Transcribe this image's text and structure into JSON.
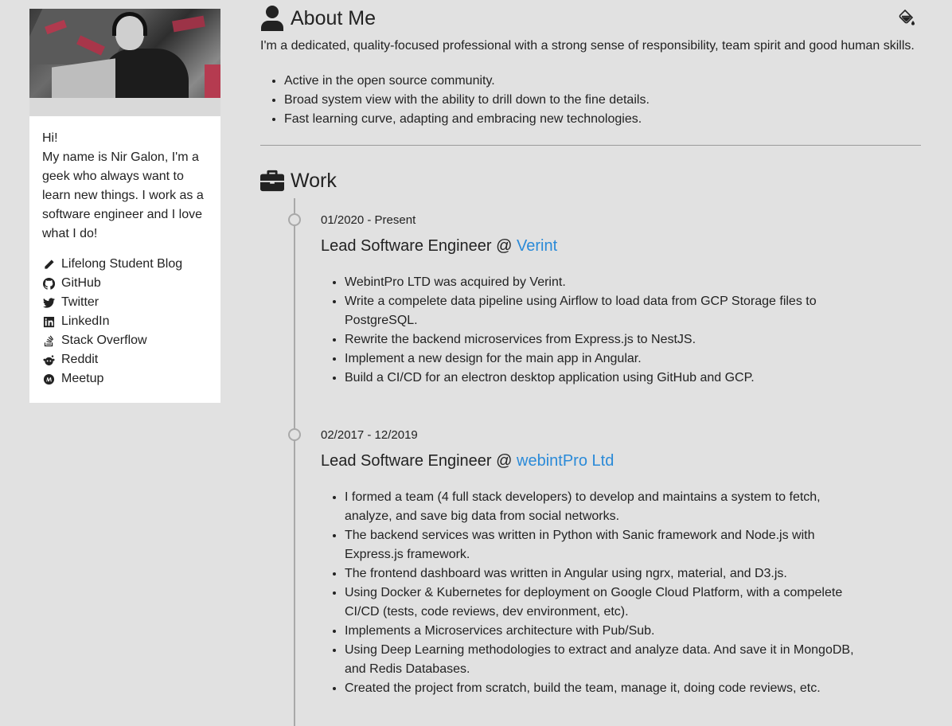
{
  "sidebar": {
    "photo_alt": "",
    "greeting": "Hi!",
    "bio": "My name is Nir Galon, I'm a geek who always want to learn new things. I work as a software engineer and I love what I do!",
    "links": [
      {
        "label": "Lifelong Student Blog",
        "icon": "pencil-icon"
      },
      {
        "label": "GitHub",
        "icon": "github-icon"
      },
      {
        "label": "Twitter",
        "icon": "twitter-icon"
      },
      {
        "label": "LinkedIn",
        "icon": "linkedin-icon"
      },
      {
        "label": "Stack Overflow",
        "icon": "stackoverflow-icon"
      },
      {
        "label": "Reddit",
        "icon": "reddit-icon"
      },
      {
        "label": "Meetup",
        "icon": "meetup-icon"
      }
    ]
  },
  "about": {
    "heading": "About Me",
    "intro": "I'm a dedicated, quality-focused professional with a strong sense of responsibility, team spirit and good human skills.",
    "points": [
      "Active in the open source community.",
      "Broad system view with the ability to drill down to the fine details.",
      "Fast learning curve, adapting and embracing new technologies."
    ]
  },
  "work": {
    "heading": "Work",
    "jobs": [
      {
        "date": "01/2020 - Present",
        "role": "Lead Software Engineer @ ",
        "company": "Verint",
        "points": [
          "WebintPro LTD was acquired by Verint.",
          "Write a compelete data pipeline using Airflow to load data from GCP Storage files to PostgreSQL.",
          "Rewrite the backend microservices from Express.js to NestJS.",
          "Implement a new design for the main app in Angular.",
          "Build a CI/CD for an electron desktop application using GitHub and GCP."
        ]
      },
      {
        "date": "02/2017 - 12/2019",
        "role": "Lead Software Engineer @ ",
        "company": "webintPro Ltd",
        "points": [
          "I formed a team (4 full stack developers) to develop and maintains a system to fetch, analyze, and save big data from social networks.",
          "The backend services was written in Python with Sanic framework and Node.js with Express.js framework.",
          "The frontend dashboard was written in Angular using ngrx, material, and D3.js.",
          "Using Docker & Kubernetes for deployment on Google Cloud Platform, with a compelete CI/CD (tests, code reviews, dev environment, etc).",
          "Implements a Microservices architecture with Pub/Sub.",
          "Using Deep Learning methodologies to extract and analyze data. And save it in MongoDB, and Redis Databases.",
          "Created the project from scratch, build the team, manage it, doing code reviews, etc."
        ]
      }
    ]
  },
  "colors": {
    "background": "#e1e1e1",
    "link": "#2a8ad8",
    "timeline": "#a9a9a9"
  }
}
